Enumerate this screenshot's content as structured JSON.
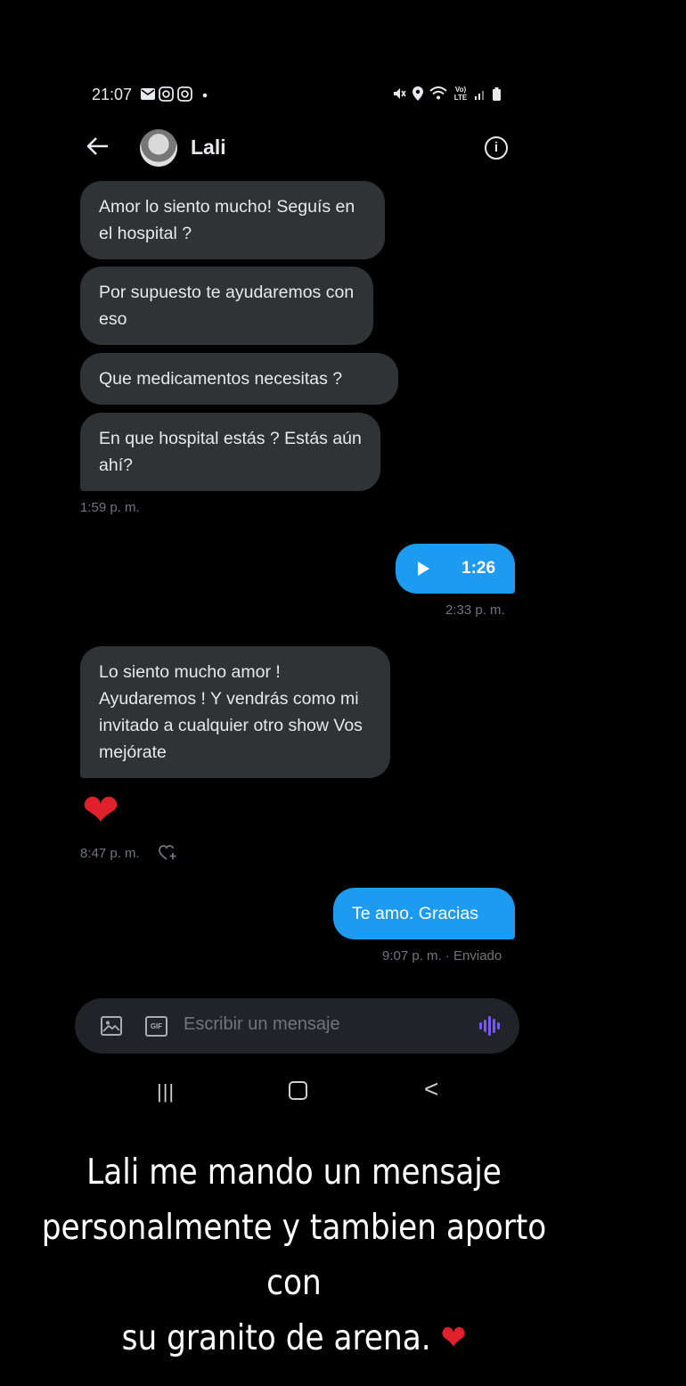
{
  "status_bar": {
    "time": "21:07",
    "left_icons": [
      "mail-icon",
      "instagram-icon",
      "instagram-icon",
      "dot-icon"
    ],
    "right_icons": [
      "mute-icon",
      "location-icon",
      "wifi-icon",
      "volte-icon",
      "signal-icon",
      "battery-icon"
    ],
    "volte_label": "Vo) LTE"
  },
  "header": {
    "contact_name": "Lali",
    "back_icon": "arrow-left-icon",
    "info_icon": "info-icon",
    "info_glyph": "i"
  },
  "messages": {
    "m1": "Amor lo siento mucho! Seguís en el hospital ?",
    "m2": "Por supuesto te ayudaremos con eso",
    "m3": "Que medicamentos necesitas ?",
    "m4": "En que hospital estás ? Estás aún ahí?",
    "ts1": "1:59 p. m.",
    "voice_duration": "1:26",
    "ts2": "2:33 p. m.",
    "m5": "Lo siento mucho amor ! Ayudaremos ! Y vendrás como mi invitado a cualquier otro show Vos mejórate",
    "heart": "❤",
    "ts3": "8:47 p. m.",
    "m6": "Te amo. Gracias",
    "ts4": "9:07 p. m. · Enviado"
  },
  "composer": {
    "placeholder": "Escribir un mensaje",
    "gif_label": "GIF"
  },
  "nav_bar": {
    "recent_glyph": "|||",
    "back_glyph": "<"
  },
  "caption": {
    "line1": "Lali me mando un mensaje",
    "line2": "personalmente y tambien aporto con",
    "line3": "su granito de arena.",
    "heart": "❤"
  },
  "colors": {
    "background": "#000000",
    "received_bubble": "#2f3336",
    "sent_bubble": "#1d9bf0",
    "timestamp": "#71767b",
    "voice_accent": "#7856ff"
  }
}
